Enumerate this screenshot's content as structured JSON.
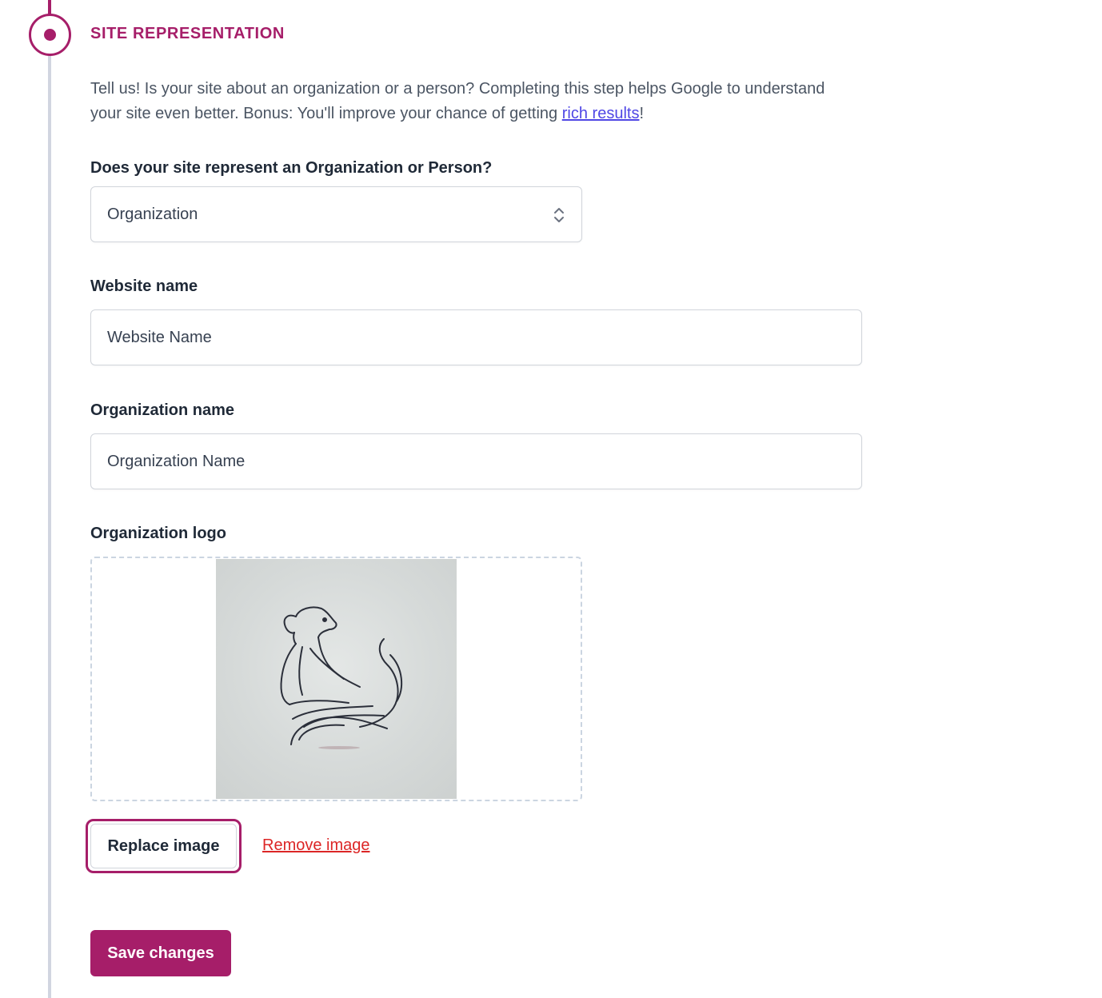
{
  "section": {
    "title": "SITE REPRESENTATION",
    "intro_text": "Tell us! Is your site about an organization or a person? Completing this step helps Google to understand your site even better. Bonus: You'll improve your chance of getting ",
    "intro_link": "rich results",
    "intro_suffix": "!"
  },
  "represent": {
    "label": "Does your site represent an Organization or Person?",
    "selected": "Organization"
  },
  "website_name": {
    "label": "Website name",
    "value": "Website Name"
  },
  "organization_name": {
    "label": "Organization name",
    "value": "Organization Name"
  },
  "organization_logo": {
    "label": "Organization logo"
  },
  "actions": {
    "replace_label": "Replace image",
    "remove_label": "Remove image",
    "save_label": "Save changes"
  },
  "colors": {
    "accent": "#a61e69",
    "link": "#4f46e5",
    "danger": "#dc2626"
  }
}
